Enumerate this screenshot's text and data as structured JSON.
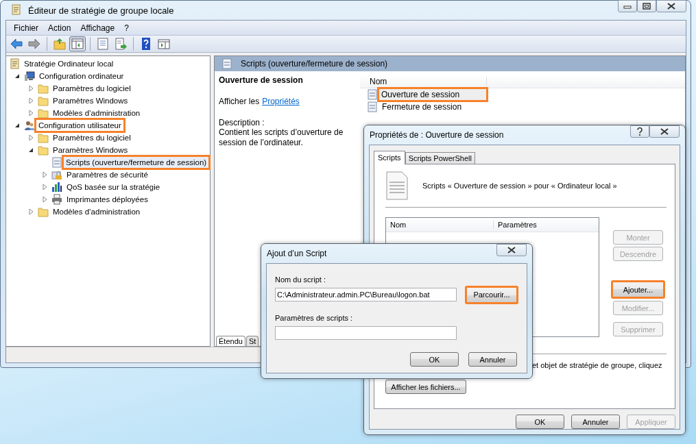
{
  "window": {
    "title": "Éditeur de stratégie de groupe locale"
  },
  "menu": [
    "Fichier",
    "Action",
    "Affichage",
    "?"
  ],
  "toolbar": [
    {
      "kind": "back",
      "pressed": false
    },
    {
      "kind": "forward",
      "pressed": false
    },
    {
      "kind": "separator"
    },
    {
      "kind": "up",
      "pressed": false
    },
    {
      "kind": "tree",
      "pressed": true
    },
    {
      "kind": "separator"
    },
    {
      "kind": "properties",
      "pressed": false
    },
    {
      "kind": "export",
      "pressed": false
    },
    {
      "kind": "separator"
    },
    {
      "kind": "help",
      "pressed": false
    },
    {
      "kind": "pane",
      "pressed": false
    }
  ],
  "tree": [
    {
      "label": "Stratégie Ordinateur local",
      "kind": "policy",
      "selected": false,
      "highlighted": false,
      "children": [
        {
          "label": "Configuration ordinateur",
          "kind": "computer",
          "expanded": true,
          "selected": false,
          "highlighted": false,
          "children": [
            {
              "label": "Paramètres du logiciel",
              "kind": "folder",
              "expanded": false,
              "selected": false,
              "highlighted": false
            },
            {
              "label": "Paramètres Windows",
              "kind": "folder",
              "expanded": false,
              "selected": false,
              "highlighted": false
            },
            {
              "label": "Modèles d’administration",
              "kind": "folder",
              "expanded": false,
              "selected": false,
              "highlighted": false
            }
          ]
        },
        {
          "label": "Configuration utilisateur",
          "kind": "user",
          "expanded": true,
          "selected": false,
          "highlighted": true,
          "children": [
            {
              "label": "Paramètres du logiciel",
              "kind": "folder",
              "expanded": false,
              "selected": false,
              "highlighted": false
            },
            {
              "label": "Paramètres Windows",
              "kind": "folder",
              "expanded": true,
              "selected": false,
              "highlighted": false,
              "children": [
                {
                  "label": "Scripts (ouverture/fermeture de session)",
                  "kind": "script",
                  "selected": true,
                  "highlighted": true
                },
                {
                  "label": "Paramètres de sécurité",
                  "kind": "security",
                  "expanded": false,
                  "selected": false,
                  "highlighted": false
                },
                {
                  "label": "QoS basée sur la stratégie",
                  "kind": "chart",
                  "expanded": false,
                  "selected": false,
                  "highlighted": false
                },
                {
                  "label": "Imprimantes déployées",
                  "kind": "printer",
                  "expanded": false,
                  "selected": false,
                  "highlighted": false
                }
              ]
            },
            {
              "label": "Modèles d’administration",
              "kind": "folder",
              "expanded": false,
              "selected": false,
              "highlighted": false
            }
          ]
        }
      ]
    }
  ],
  "details": {
    "header": "Scripts (ouverture/fermeture de session)",
    "heading": "Ouverture de session",
    "link_prefix": "Afficher les",
    "link": "Propriétés",
    "description_label": "Description :",
    "description": "Contient les scripts d’ouverture de session de l’ordinateur.",
    "column": "Nom",
    "items": [
      {
        "label": "Ouverture de session",
        "selected": true,
        "highlighted": true
      },
      {
        "label": "Fermeture de session",
        "selected": false,
        "highlighted": false
      }
    ]
  },
  "view_tabs": [
    {
      "label": "Étendu",
      "selected": true
    },
    {
      "label": "St",
      "selected": false
    }
  ],
  "properties_dialog": {
    "title": "Propriétés de : Ouverture de session",
    "tabs": [
      {
        "label": "Scripts",
        "selected": true
      },
      {
        "label": "Scripts PowerShell",
        "selected": false
      }
    ],
    "caption": "Scripts « Ouverture de session » pour « Ordinateur local »",
    "columns": [
      "Nom",
      "Paramètres"
    ],
    "side_buttons": [
      {
        "label": "Monter",
        "disabled": true,
        "highlighted": false
      },
      {
        "label": "Descendre",
        "disabled": true,
        "highlighted": false
      },
      {
        "label": "Ajouter...",
        "disabled": false,
        "highlighted": true
      },
      {
        "label": "Modifier...",
        "disabled": true,
        "highlighted": false
      },
      {
        "label": "Supprimer",
        "disabled": true,
        "highlighted": false
      }
    ],
    "note": "et objet de stratégie de groupe, cliquez",
    "show_files_button": "Afficher les fichiers...",
    "buttons": [
      {
        "label": "OK",
        "disabled": false
      },
      {
        "label": "Annuler",
        "disabled": false
      },
      {
        "label": "Appliquer",
        "disabled": true
      }
    ]
  },
  "add_dialog": {
    "title": "Ajout d’un Script",
    "name_label": "Nom du script :",
    "name_value": "C:\\Administrateur.admin.PC\\Bureau\\logon.bat",
    "browse_button": {
      "label": "Parcourir...",
      "highlighted": true
    },
    "params_label": "Paramètres de scripts :",
    "buttons": [
      {
        "label": "OK"
      },
      {
        "label": "Annuler"
      }
    ]
  }
}
